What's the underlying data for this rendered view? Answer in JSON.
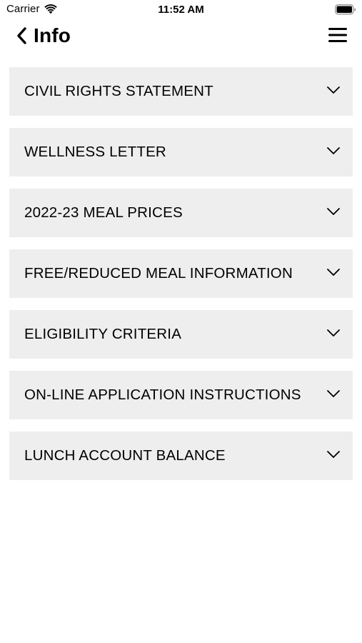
{
  "status_bar": {
    "carrier": "Carrier",
    "time": "11:52 AM"
  },
  "nav": {
    "title": "Info",
    "back_icon": "chevron-left-icon",
    "menu_icon": "hamburger-menu-icon"
  },
  "accordion": {
    "items": [
      {
        "label": "CIVIL RIGHTS STATEMENT",
        "expanded": false
      },
      {
        "label": "WELLNESS LETTER",
        "expanded": false
      },
      {
        "label": "2022-23 MEAL PRICES",
        "expanded": false
      },
      {
        "label": "FREE/REDUCED MEAL INFORMATION",
        "expanded": false
      },
      {
        "label": "ELIGIBILITY CRITERIA",
        "expanded": false
      },
      {
        "label": "ON-LINE APPLICATION INSTRUCTIONS",
        "expanded": false
      },
      {
        "label": "LUNCH ACCOUNT BALANCE",
        "expanded": false
      }
    ]
  },
  "colors": {
    "row_background": "#eeeeee",
    "text": "#000000",
    "page_background": "#ffffff"
  }
}
